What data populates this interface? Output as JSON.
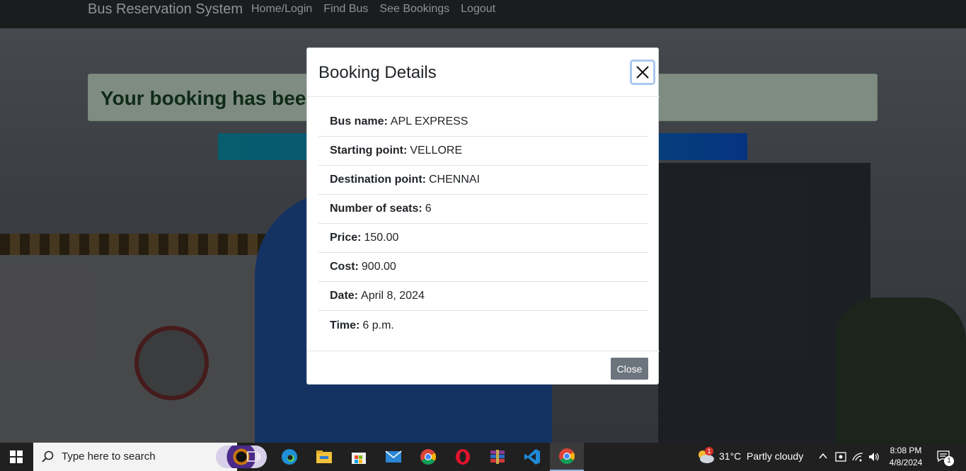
{
  "navbar": {
    "brand": "Bus Reservation System",
    "links": [
      "Home/Login",
      "Find Bus",
      "See Bookings",
      "Logout"
    ]
  },
  "alert": {
    "text": "Your booking has been"
  },
  "modal": {
    "title": "Booking Details",
    "close_label": "Close",
    "details": [
      {
        "label": "Bus name:",
        "value": "APL EXPRESS"
      },
      {
        "label": "Starting point:",
        "value": "VELLORE"
      },
      {
        "label": "Destination point:",
        "value": "CHENNAI"
      },
      {
        "label": "Number of seats:",
        "value": "6"
      },
      {
        "label": "Price:",
        "value": "150.00"
      },
      {
        "label": "Cost:",
        "value": "900.00"
      },
      {
        "label": "Date:",
        "value": "April 8, 2024"
      },
      {
        "label": "Time:",
        "value": "6 p.m."
      }
    ]
  },
  "taskbar": {
    "search_placeholder": "Type here to search",
    "weather": "31°C  Partly cloudy",
    "weather_badge": "1",
    "time": "8:08 PM",
    "date": "4/8/2024",
    "notification_count": "1",
    "icons": [
      "task-view-icon",
      "edge-icon",
      "file-explorer-icon",
      "store-icon",
      "mail-icon",
      "chrome-icon",
      "opera-icon",
      "winrar-icon",
      "vscode-icon",
      "chrome-active-icon"
    ]
  },
  "colors": {
    "navbar_bg": "#1a1c1e",
    "alert_bg": "#c3d8c6",
    "alert_text": "#184226",
    "close_button_bg": "#6c757d",
    "taskbar_bg": "#202020"
  }
}
